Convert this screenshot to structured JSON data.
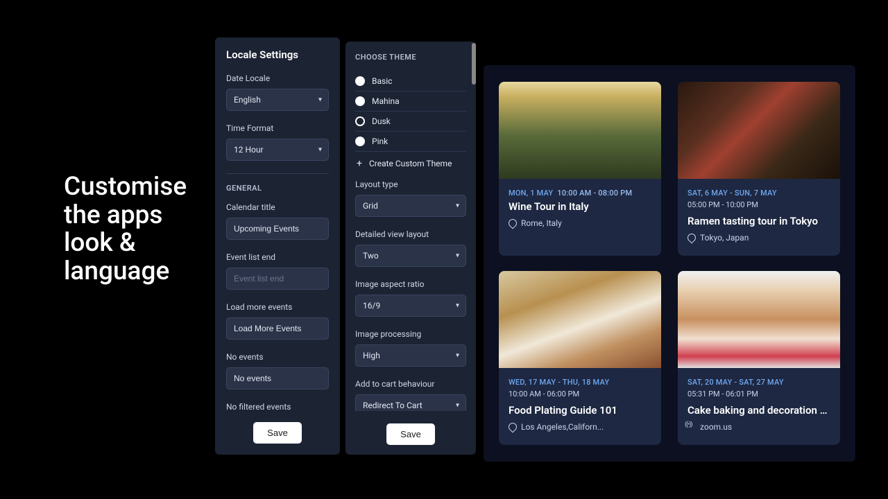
{
  "hero": "Customise the apps look & language",
  "locale_panel": {
    "title": "Locale Settings",
    "date_locale_label": "Date Locale",
    "date_locale_value": "English",
    "time_format_label": "Time Format",
    "time_format_value": "12 Hour",
    "general_label": "GENERAL",
    "calendar_title_label": "Calendar title",
    "calendar_title_value": "Upcoming Events",
    "event_list_end_label": "Event list end",
    "event_list_end_placeholder": "Event list end",
    "load_more_label": "Load more events",
    "load_more_value": "Load More Events",
    "no_events_label": "No events",
    "no_events_value": "No events",
    "no_filtered_label": "No filtered events",
    "save": "Save"
  },
  "theme_panel": {
    "section": "CHOOSE THEME",
    "themes": [
      {
        "label": "Basic",
        "selected": false
      },
      {
        "label": "Mahina",
        "selected": false
      },
      {
        "label": "Dusk",
        "selected": true
      },
      {
        "label": "Pink",
        "selected": false
      }
    ],
    "create_custom": "Create Custom Theme",
    "layout_type_label": "Layout type",
    "layout_type_value": "Grid",
    "detailed_view_label": "Detailed view layout",
    "detailed_view_value": "Two",
    "aspect_label": "Image aspect ratio",
    "aspect_value": "16/9",
    "processing_label": "Image processing",
    "processing_value": "High",
    "cart_label": "Add to cart behaviour",
    "cart_value": "Redirect To Cart",
    "save": "Save"
  },
  "cards": [
    {
      "date_line": "MON, 1 MAY",
      "time_inline": "10:00 AM - 08:00 PM",
      "title": "Wine Tour in Italy",
      "location": "Rome, Italy",
      "loc_type": "pin"
    },
    {
      "date_line": "SAT, 6 MAY - SUN, 7 MAY",
      "time_below": "05:00 PM - 10:00 PM",
      "title": "Ramen tasting tour in Tokyo",
      "location": "Tokyo, Japan",
      "loc_type": "pin"
    },
    {
      "date_line": "WED, 17 MAY - THU, 18 MAY",
      "time_below": "10:00 AM - 06:00 PM",
      "title": "Food Plating Guide 101",
      "location": "Los Angeles,Californ...",
      "loc_type": "pin"
    },
    {
      "date_line": "SAT, 20 MAY - SAT, 27 MAY",
      "time_below": "05:31 PM - 06:01 PM",
      "title": "Cake baking and decoration class",
      "location": "zoom.us",
      "loc_type": "wifi"
    }
  ]
}
